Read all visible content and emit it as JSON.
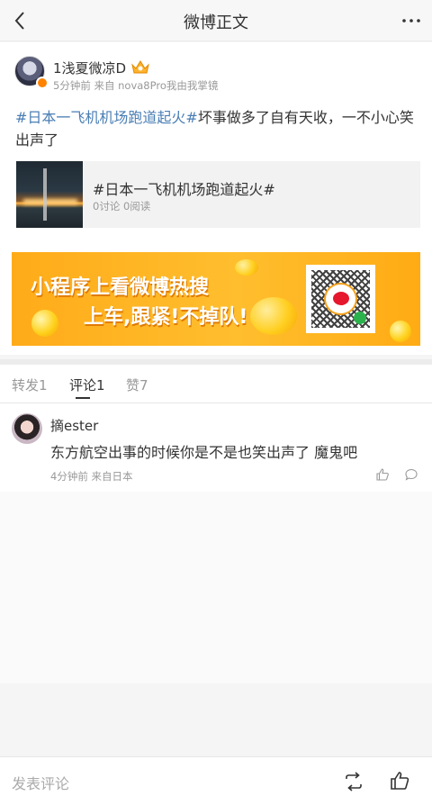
{
  "nav": {
    "title": "微博正文"
  },
  "post": {
    "username": "1浅夏微凉D",
    "meta": "5分钟前 来自 nova8Pro我由我掌镜",
    "topic_link": "#日本一飞机机场跑道起火#",
    "body_rest": "坏事做多了自有天收，一不小心笑出声了",
    "topic_card": {
      "title": "#日本一飞机机场跑道起火#",
      "stats": "0讨论 0阅读"
    }
  },
  "banner": {
    "line1": "小程序上看微博热搜",
    "line2": "上车,跟紧!不掉队!"
  },
  "tabs": [
    {
      "label": "转发1",
      "active": false
    },
    {
      "label": "评论1",
      "active": true
    },
    {
      "label": "赞7",
      "active": false
    }
  ],
  "comments": [
    {
      "username": "摘ester",
      "text": "东方航空出事的时候你是不是也笑出声了 魔鬼吧",
      "meta": "4分钟前 来自日本"
    }
  ],
  "bottom_bar": {
    "placeholder": "发表评论"
  },
  "colors": {
    "link": "#4a7eb4",
    "accent": "#ff8200",
    "banner": "#ffb020"
  }
}
